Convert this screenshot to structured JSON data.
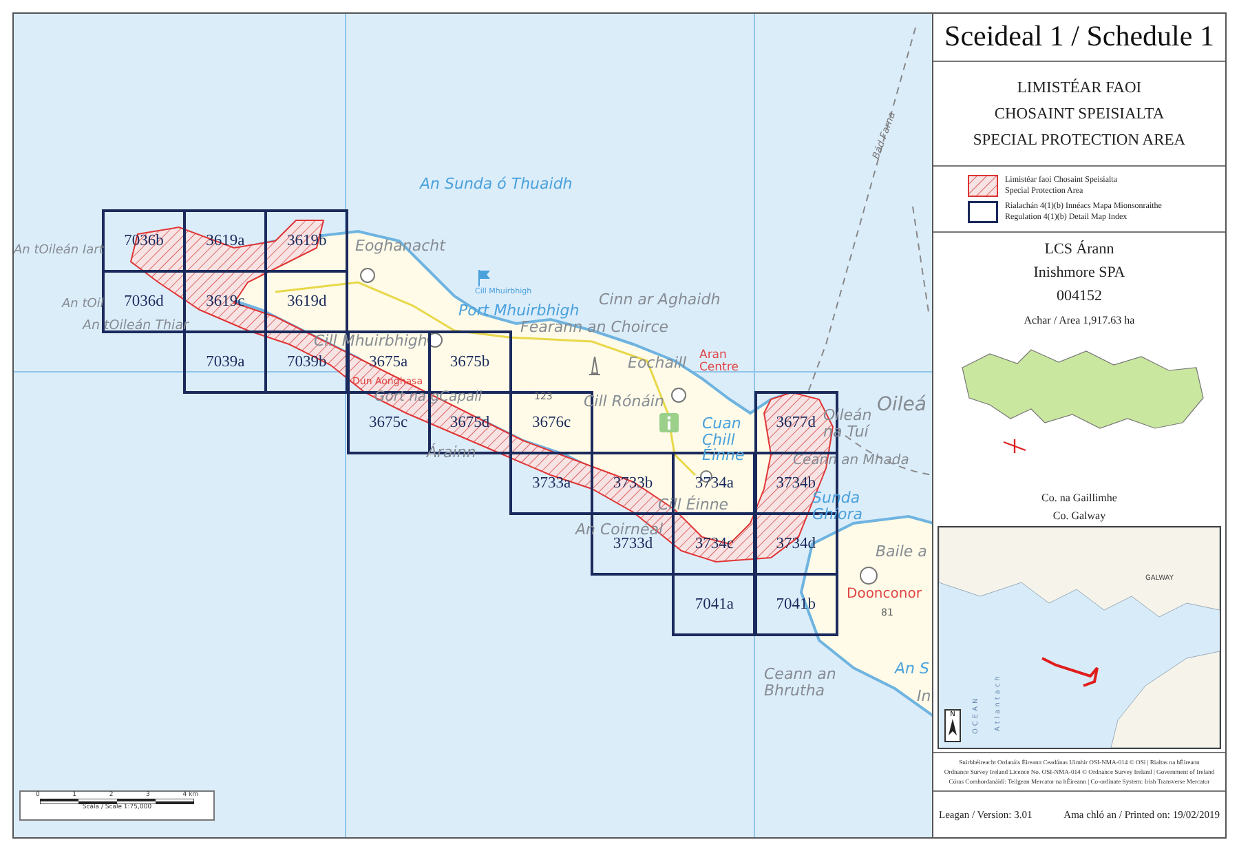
{
  "header": {
    "title": "Sceideal 1 / Schedule 1"
  },
  "designation": {
    "lines": [
      "LIMISTÉAR FAOI",
      "CHOSAINT SPEISIALTA",
      "SPECIAL PROTECTION AREA"
    ]
  },
  "legend": [
    {
      "kind": "spa",
      "lines": [
        "Limistéar faoi Chosaint Speisialta",
        "Special Protection Area"
      ]
    },
    {
      "kind": "grid",
      "lines": [
        "Rialachán 4(1)(b) Innéacs Mapa Mionsonraithe",
        "Regulation 4(1)(b) Detail Map Index"
      ]
    }
  ],
  "site": {
    "name_ga": "LCS Árann",
    "name_en": "Inishmore SPA",
    "code": "004152",
    "area": "Achar / Area 1,917.63 ha"
  },
  "county": {
    "name_ga": "Co. na Gaillimhe",
    "name_en": "Co. Galway"
  },
  "inset_map": {
    "labels": [
      {
        "text": "GALWAY",
        "kind": "town"
      },
      {
        "text": "OCEAN",
        "kind": "sea"
      },
      {
        "text": "Atlantach",
        "kind": "sea"
      }
    ],
    "north": "N"
  },
  "credits": [
    "Suirbhéireacht Ordanáis Éireann Ceadúnas Uimhir OSI-NMA-014 © OSi | Rialtas na hÉireann",
    "Ordnance Survey Ireland Licence No. OSI-NMA-014 © Ordnance Survey Ireland | Government of Ireland",
    "Córas Comhordanáidí: Teilgean Mercator na hÉireann | Co-ordinate System: Irish Transverse Mercator"
  ],
  "footer": {
    "version": "Leagan / Version: 3.01",
    "printed": "Ama chló an / Printed on: 19/02/2019"
  },
  "map": {
    "tiles": [
      "7036b",
      "3619a",
      "3619b",
      "7036d",
      "3619c",
      "3619d",
      "7039a",
      "7039b",
      "3675a",
      "3675b",
      "3675c",
      "3675d",
      "3676c",
      "3677d",
      "3733a",
      "3733b",
      "3734a",
      "3734b",
      "3733d",
      "3734c",
      "3734d",
      "7041a",
      "7041b"
    ],
    "labels": [
      {
        "text": "An Sunda ó Thuaidh",
        "kind": "water"
      },
      {
        "text": "An tOileán Iart",
        "kind": "place"
      },
      {
        "text": "An tOil",
        "kind": "place"
      },
      {
        "text": "An tOileán Thiar",
        "kind": "place"
      },
      {
        "text": "Eoghanacht",
        "kind": "place"
      },
      {
        "text": "Cill Mhuirbhigh",
        "kind": "tiny"
      },
      {
        "text": "Port Mhuirbhigh",
        "kind": "water"
      },
      {
        "text": "Cinn ar Aghaidh",
        "kind": "place"
      },
      {
        "text": "Fearann an Choirce",
        "kind": "place"
      },
      {
        "text": "Cill Mhuirbhigh",
        "kind": "place"
      },
      {
        "text": "Eochaill",
        "kind": "place"
      },
      {
        "text": "Aran Centre",
        "kind": "poi"
      },
      {
        "text": "123",
        "kind": "height"
      },
      {
        "text": "Cill Rónáin",
        "kind": "place"
      },
      {
        "text": "Cuan Chill Éinne",
        "kind": "water"
      },
      {
        "text": "Oileá",
        "kind": "place"
      },
      {
        "text": "Oileán na Tuí",
        "kind": "place"
      },
      {
        "text": "Ceann an Mhada",
        "kind": "place"
      },
      {
        "text": "Sunda Ghíora",
        "kind": "water"
      },
      {
        "text": "An Coirnéal",
        "kind": "place"
      },
      {
        "text": "Cill Éinne",
        "kind": "place"
      },
      {
        "text": "Baile a",
        "kind": "place"
      },
      {
        "text": "Doonconor",
        "kind": "poi"
      },
      {
        "text": "81",
        "kind": "height"
      },
      {
        "text": "An S",
        "kind": "water"
      },
      {
        "text": "Ceann an Bhrutha",
        "kind": "place"
      },
      {
        "text": "In",
        "kind": "place"
      },
      {
        "text": "Gort na gCapall",
        "kind": "place"
      },
      {
        "text": "Árainn",
        "kind": "place"
      },
      {
        "text": "Dún Aonghasa",
        "kind": "poi"
      },
      {
        "text": "Bád Farna",
        "kind": "ferry"
      }
    ]
  },
  "scale_bar": {
    "ticks": [
      "0",
      "1",
      "2",
      "3",
      "4 km"
    ],
    "caption": "Scála / Scale 1:75,000"
  }
}
